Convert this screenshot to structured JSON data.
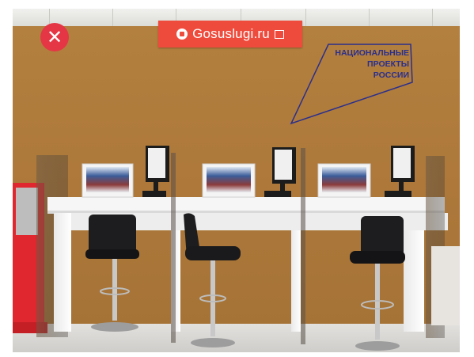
{
  "close_button": {
    "icon": "close-icon",
    "label": "✕",
    "color": "#e53645"
  },
  "sign": {
    "text": "Gosuslugi.ru",
    "color": "#ef4b3c",
    "logo_icon": "gosuslugi-logo-icon"
  },
  "overlay": {
    "lines": [
      "НАЦИОНАЛЬНЫЕ",
      "ПРОЕКТЫ",
      "РОССИИ"
    ],
    "color": "#2a2f8c"
  },
  "colors": {
    "wall": "#b07a40",
    "desk": "#f4f4f4",
    "chair": "#1d1d1f",
    "floor": "#dcdad7"
  }
}
